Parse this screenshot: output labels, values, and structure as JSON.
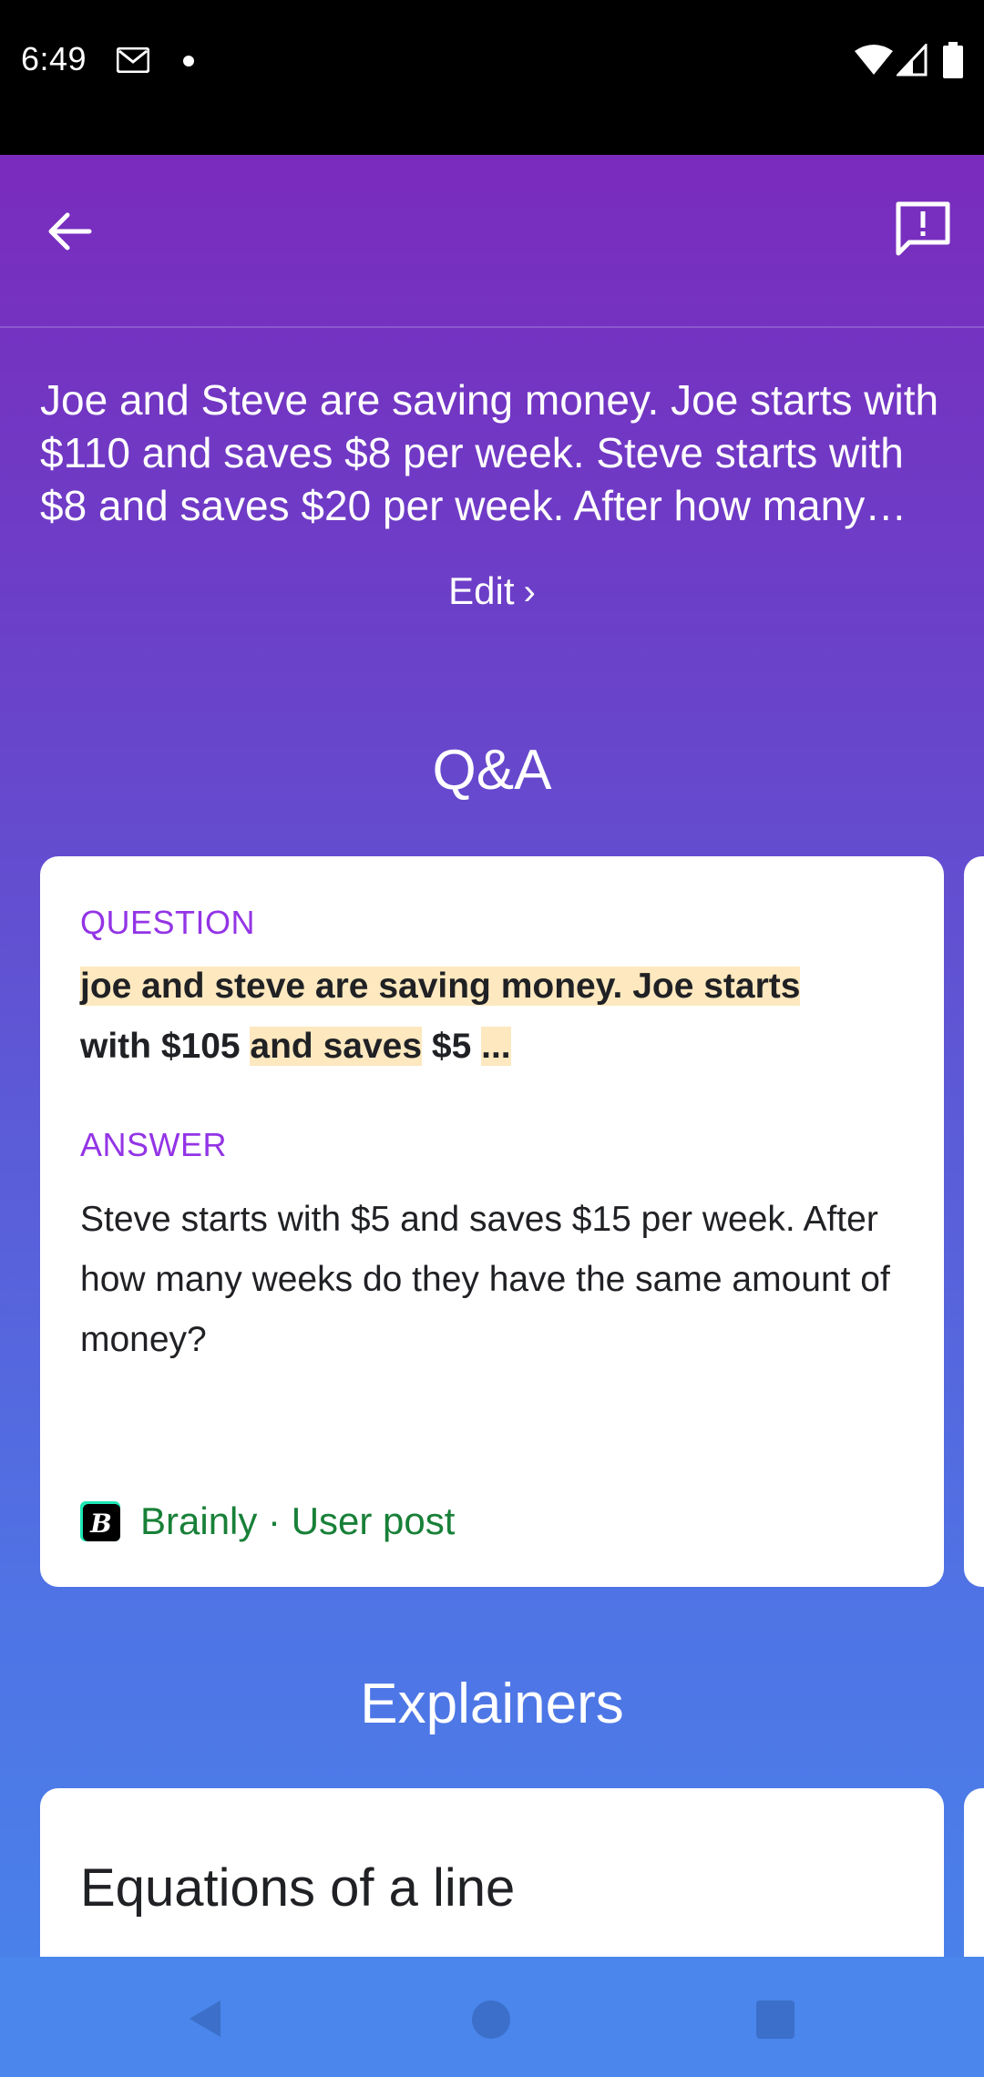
{
  "status_bar": {
    "time": "6:49",
    "icons": [
      "gmail-icon",
      "notification-dot-icon",
      "wifi-icon",
      "signal-icon",
      "battery-icon"
    ]
  },
  "toolbar": {
    "back_icon": "arrow-left-icon",
    "report_icon": "feedback-icon"
  },
  "query": {
    "text": "Joe and Steve are saving money. Joe starts with $110 and saves $8 per week. Steve starts with $8 and saves $20 per week. After how many weeks do they have the same amount of money?",
    "edit_label": "Edit"
  },
  "qa": {
    "section_title": "Q&A",
    "question_label": "QUESTION",
    "question_parts": {
      "p1": "joe and steve are saving money. Joe starts",
      "p2": "with $105 ",
      "p3": "and saves",
      "p4": " $5 ",
      "p5": "..."
    },
    "answer_label": "ANSWER",
    "answer_text": "Steve starts with $5 and saves $15 per week. After how many weeks do they have the same amount of money?",
    "source": "Brainly · User post"
  },
  "explainers": {
    "section_title": "Explainers",
    "first_title": "Equations of a line"
  },
  "nav_bar": {
    "icons": [
      "nav-back-icon",
      "nav-home-icon",
      "nav-recents-icon"
    ]
  },
  "colors": {
    "gradient_top": "#7a2bbd",
    "gradient_bottom": "#4a80ea",
    "label_purple": "#9334e6",
    "source_green": "#188038",
    "highlight": "#fde8bf"
  }
}
